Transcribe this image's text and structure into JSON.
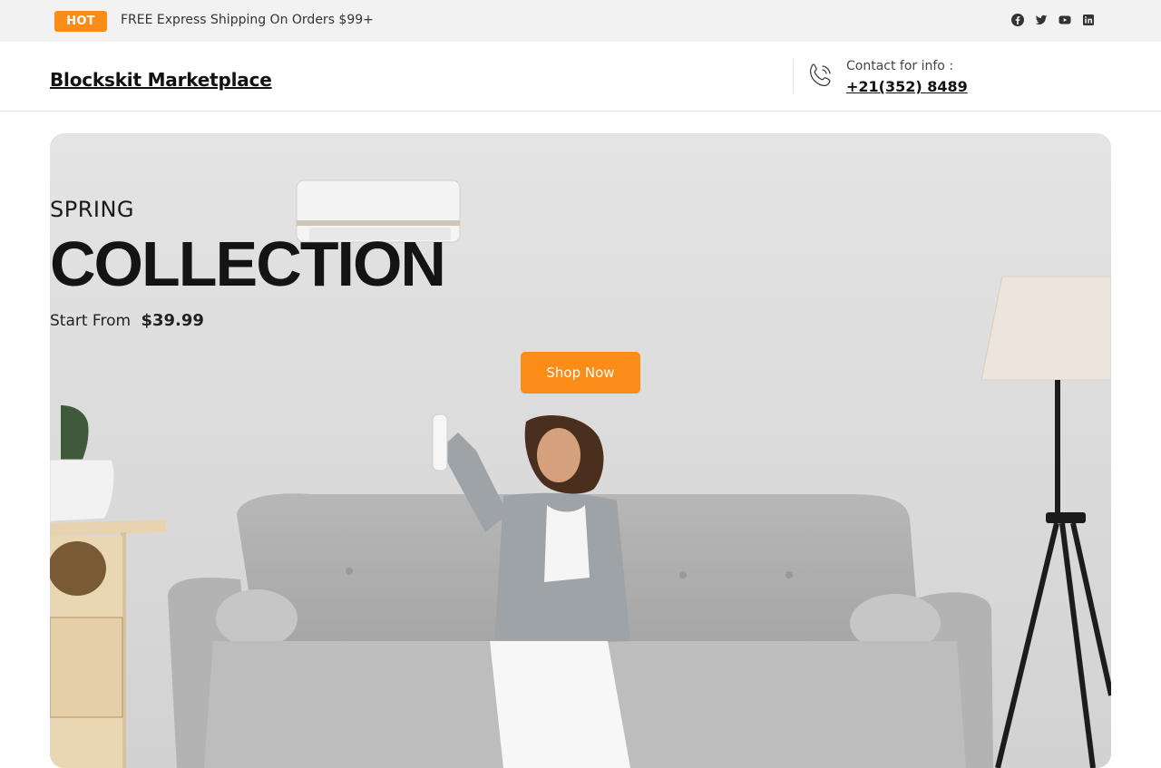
{
  "topbar": {
    "badge": "HOT",
    "promo": "FREE Express Shipping On Orders $99+",
    "social_icons": [
      "facebook-icon",
      "twitter-icon",
      "youtube-icon",
      "linkedin-icon"
    ]
  },
  "header": {
    "brand": "Blockskit Marketplace",
    "contact_label": "Contact for info :",
    "contact_number": "+21(352) 8489"
  },
  "hero": {
    "eyebrow": "SPRING",
    "headline": "COLLECTION",
    "price_prefix": "Start From",
    "price": "$39.99",
    "cta": "Shop Now"
  },
  "colors": {
    "accent": "#fb8c17",
    "topbar_bg": "#f2f2f2",
    "text": "#111111"
  }
}
